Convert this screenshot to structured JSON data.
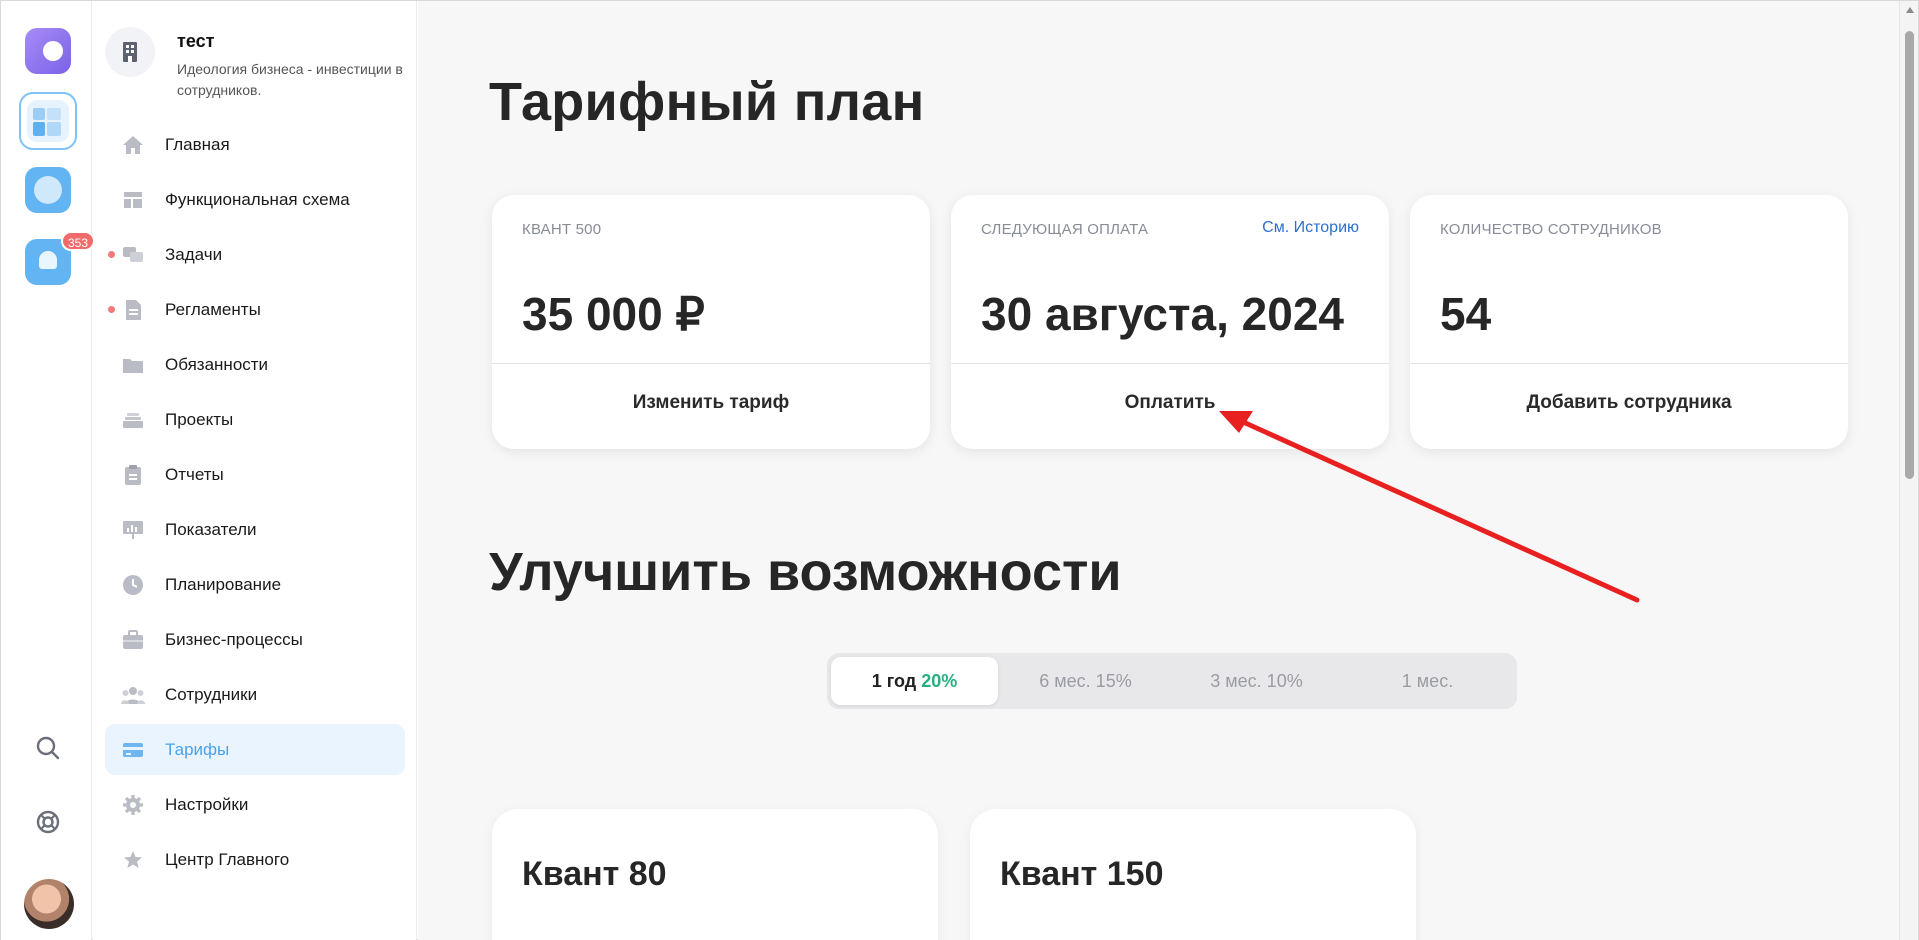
{
  "rail": {
    "notifications_badge": "353"
  },
  "org": {
    "name": "тест",
    "description": "Идеология бизнеса - инвестиции в сотрудников."
  },
  "nav": [
    {
      "label": "Главная",
      "icon": "home-icon"
    },
    {
      "label": "Функциональная схема",
      "icon": "layout-icon"
    },
    {
      "label": "Задачи",
      "icon": "chat-icon",
      "dot": true
    },
    {
      "label": "Регламенты",
      "icon": "document-icon",
      "dot": true
    },
    {
      "label": "Обязанности",
      "icon": "folder-icon"
    },
    {
      "label": "Проекты",
      "icon": "stack-icon"
    },
    {
      "label": "Отчеты",
      "icon": "clipboard-icon"
    },
    {
      "label": "Показатели",
      "icon": "presentation-icon"
    },
    {
      "label": "Планирование",
      "icon": "clock-icon"
    },
    {
      "label": "Бизнес-процессы",
      "icon": "briefcase-icon"
    },
    {
      "label": "Сотрудники",
      "icon": "people-icon"
    },
    {
      "label": "Тарифы",
      "icon": "card-icon",
      "active": true
    },
    {
      "label": "Настройки",
      "icon": "gear-icon"
    },
    {
      "label": "Центр Главного",
      "icon": "star-icon"
    }
  ],
  "main": {
    "title": "Тарифный план",
    "cards": {
      "plan": {
        "label": "КВАНТ 500",
        "value": "35 000 ₽",
        "action": "Изменить тариф"
      },
      "payment": {
        "label": "СЛЕДУЮЩАЯ ОПЛАТА",
        "link": "См. Историю",
        "value": "30 августа, 2024",
        "action": "Оплатить"
      },
      "employees": {
        "label": "КОЛИЧЕСТВО СОТРУДНИКОВ",
        "value": "54",
        "action": "Добавить сотрудника"
      }
    },
    "upgrade_title": "Улучшить возможности",
    "periods": [
      {
        "label": "1 год",
        "discount": "20%",
        "selected": true
      },
      {
        "label": "6 мес. 15%"
      },
      {
        "label": "3 мес. 10%"
      },
      {
        "label": "1 мес."
      }
    ],
    "plans": [
      {
        "name": "Квант 80"
      },
      {
        "name": "Квант 150"
      }
    ]
  },
  "colors": {
    "accent": "#49a3ec",
    "link": "#2b6fd0",
    "discount": "#27b07f",
    "annotation_arrow": "#e8201f",
    "badge": "#f26b6b"
  }
}
